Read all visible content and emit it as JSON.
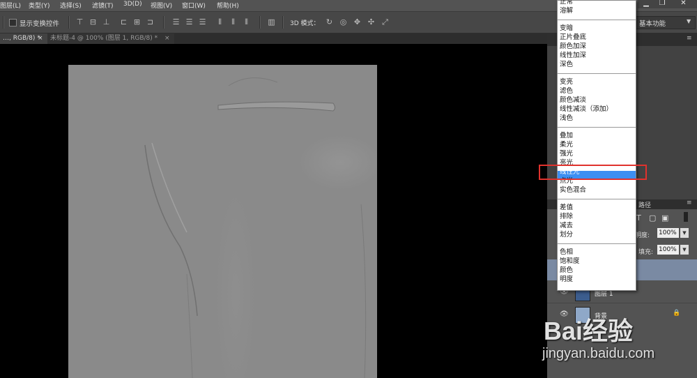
{
  "menubar": {
    "items": [
      "图层(L)",
      "类型(Y)",
      "选择(S)",
      "滤镜(T)",
      "3D(D)",
      "视图(V)",
      "窗口(W)",
      "帮助(H)"
    ]
  },
  "options": {
    "show_transform_label": "显示变换控件",
    "mode3d_label": "3D 模式：",
    "workspace": "基本功能"
  },
  "tabs": [
    {
      "label": "…, RGB/8) *",
      "close": "×"
    },
    {
      "label": "未标题-4 @ 100% (图层 1, RGB/8) *",
      "close": "×"
    }
  ],
  "blend_groups": [
    [
      "正常",
      "溶解"
    ],
    [
      "变暗",
      "正片叠底",
      "颜色加深",
      "线性加深",
      "深色"
    ],
    [
      "变亮",
      "滤色",
      "颜色减淡",
      "线性减淡（添加）",
      "浅色"
    ],
    [
      "叠加",
      "柔光",
      "强光",
      "亮光",
      "线性光",
      "点光",
      "实色混合"
    ],
    [
      "差值",
      "排除",
      "减去",
      "划分"
    ],
    [
      "色相",
      "饱和度",
      "颜色",
      "明度"
    ]
  ],
  "blend_selected": "线性光",
  "layers_panel": {
    "paths_tab": "路径",
    "opacity_label": "透明度:",
    "opacity_value": "100%",
    "fill_label": "填充:",
    "fill_value": "100%",
    "layers": [
      {
        "name": "图层 1"
      },
      {
        "name": "背景"
      }
    ]
  },
  "watermark": {
    "brand": "Bai经验",
    "url": "jingyan.baidu.com"
  },
  "colors": {
    "selection": "#3d8ff2",
    "highlight_box": "#e0322d"
  }
}
